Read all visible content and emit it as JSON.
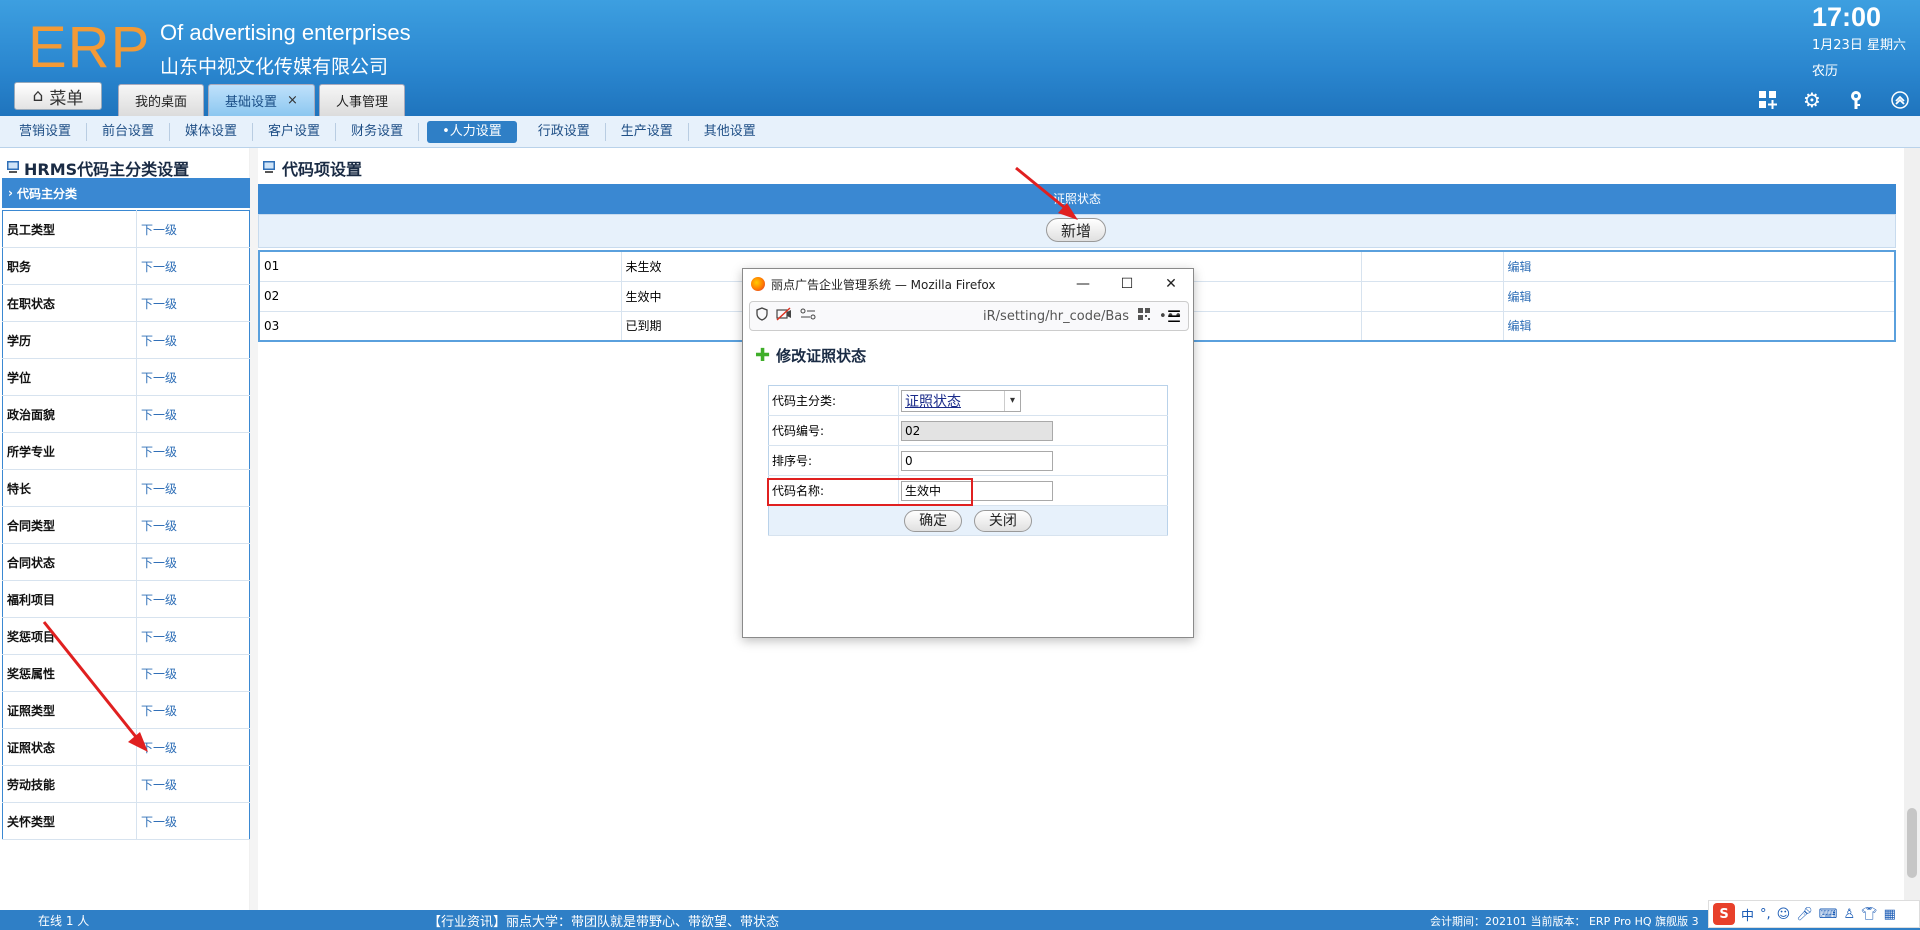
{
  "header": {
    "logo": "ERP",
    "company_en": "Of advertising enterprises",
    "company_cn": "山东中视文化传媒有限公司",
    "time": "17:00",
    "date": "1月23日 星期六",
    "lunar": "农历",
    "menu_label": "菜单",
    "tabs": [
      {
        "label": "我的桌面",
        "closable": false
      },
      {
        "label": "基础设置",
        "closable": true
      },
      {
        "label": "人事管理",
        "closable": false
      }
    ],
    "tab_close": "×"
  },
  "subnav": {
    "items": [
      "营销设置",
      "前台设置",
      "媒体设置",
      "客户设置",
      "财务设置",
      "•人力设置",
      "行政设置",
      "生产设置",
      "其他设置"
    ],
    "active_index": 5
  },
  "left_panel": {
    "title": "HRMS代码主分类设置",
    "section": "代码主分类",
    "link_label": "下一级",
    "rows": [
      "员工类型",
      "职务",
      "在职状态",
      "学历",
      "学位",
      "政治面貌",
      "所学专业",
      "特长",
      "合同类型",
      "合同状态",
      "福利项目",
      "奖惩项目",
      "奖惩属性",
      "证照类型",
      "证照状态",
      "劳动技能",
      "关怀类型"
    ]
  },
  "main": {
    "title": "代码项设置",
    "table_header": "证照状态",
    "add_button": "新增",
    "edit_label": "编辑",
    "rows": [
      {
        "code": "01",
        "name": "未生效"
      },
      {
        "code": "02",
        "name": "生效中"
      },
      {
        "code": "03",
        "name": "已到期"
      }
    ]
  },
  "popup": {
    "window_title": "丽点广告企业管理系统 — Mozilla Firefox",
    "url": "iR/setting/hr_code/Bas",
    "heading": "修改证照状态",
    "fields": {
      "category_label": "代码主分类:",
      "category_value": "证照状态",
      "code_label": "代码编号:",
      "code_value": "02",
      "order_label": "排序号:",
      "order_value": "0",
      "name_label": "代码名称:",
      "name_value": "生效中"
    },
    "confirm": "确定",
    "close": "关闭"
  },
  "footer": {
    "online": "在线   1   人",
    "news": "【行业资讯】丽点大学：带团队就是带野心、带欲望、带状态",
    "period": "会计期间：202101 当前版本： ERP Pro HQ 旗舰版 3",
    "ime_label": "中"
  },
  "colors": {
    "header_blue": "#2a86cf",
    "accent_blue": "#3a88d2",
    "logo_orange": "#f39a36",
    "annotation_red": "#e02020"
  }
}
